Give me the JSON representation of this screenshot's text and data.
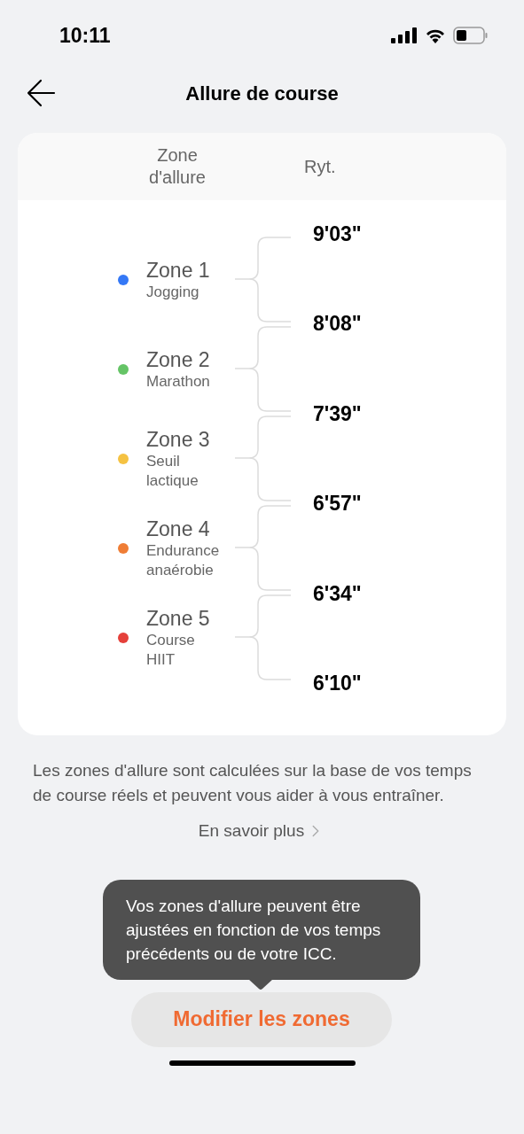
{
  "status_bar": {
    "time": "10:11"
  },
  "header": {
    "title": "Allure de course"
  },
  "table": {
    "columns": [
      "Zone\nd'allure",
      "Ryt."
    ],
    "zones": [
      {
        "name": "Zone 1",
        "label": "Jogging",
        "color": "#3478f6"
      },
      {
        "name": "Zone 2",
        "label": "Marathon",
        "color": "#65c466"
      },
      {
        "name": "Zone 3",
        "label": "Seuil\nlactique",
        "color": "#f5c242"
      },
      {
        "name": "Zone 4",
        "label": "Endurance\nanaérobie",
        "color": "#ef7d35"
      },
      {
        "name": "Zone 5",
        "label": "Course\nHIIT",
        "color": "#e5403a"
      }
    ],
    "paces": [
      "9'03\"",
      "8'08\"",
      "7'39\"",
      "6'57\"",
      "6'34\"",
      "6'10\""
    ]
  },
  "description": "Les zones d'allure sont calculées sur la base de vos temps de course réels et peuvent vous aider à vous entraîner.",
  "learn_more": "En savoir plus",
  "tooltip": "Vos zones d'allure peuvent être ajustées en fonction de vos temps précédents ou de votre ICC.",
  "button": "Modifier les zones"
}
